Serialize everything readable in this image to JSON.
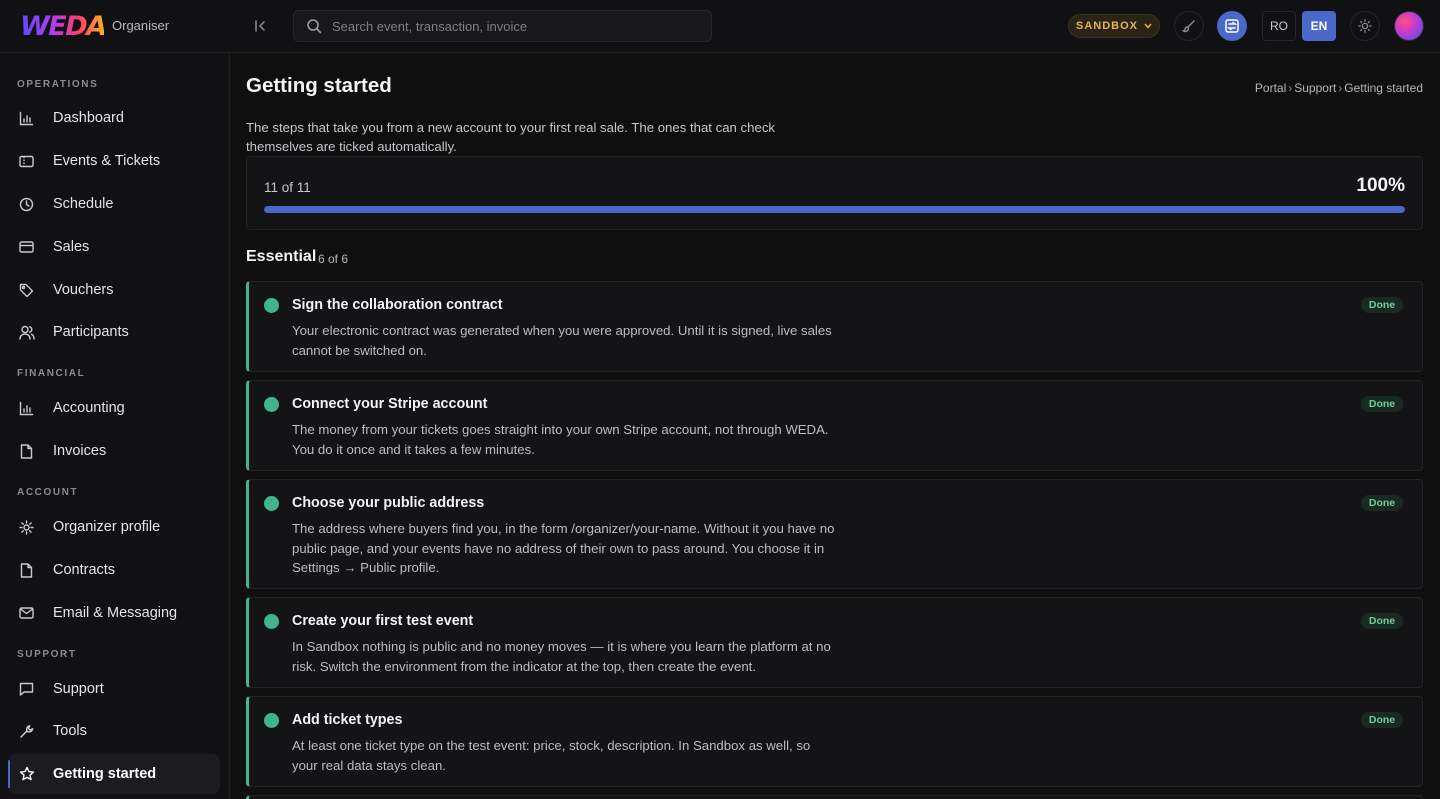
{
  "header": {
    "brand": "WEDA",
    "brand_sub": "Organiser",
    "search_placeholder": "Search event, transaction, invoice",
    "env_label": "SANDBOX",
    "lang_ro": "RO",
    "lang_en": "EN",
    "active_lang": "EN"
  },
  "sidebar": {
    "sections": [
      {
        "title": "OPERATIONS",
        "items": [
          {
            "label": "Dashboard",
            "icon": "chart-icon"
          },
          {
            "label": "Events & Tickets",
            "icon": "ticket-icon"
          },
          {
            "label": "Schedule",
            "icon": "clock-icon"
          },
          {
            "label": "Sales",
            "icon": "card-icon"
          },
          {
            "label": "Vouchers",
            "icon": "tag-icon"
          },
          {
            "label": "Participants",
            "icon": "users-icon"
          }
        ]
      },
      {
        "title": "FINANCIAL",
        "items": [
          {
            "label": "Accounting",
            "icon": "chart-icon"
          },
          {
            "label": "Invoices",
            "icon": "document-icon"
          }
        ]
      },
      {
        "title": "ACCOUNT",
        "items": [
          {
            "label": "Organizer profile",
            "icon": "gear-icon"
          },
          {
            "label": "Contracts",
            "icon": "document-icon"
          },
          {
            "label": "Email & Messaging",
            "icon": "mail-icon"
          }
        ]
      },
      {
        "title": "SUPPORT",
        "items": [
          {
            "label": "Support",
            "icon": "chat-icon"
          },
          {
            "label": "Tools",
            "icon": "wrench-icon"
          },
          {
            "label": "Getting started",
            "icon": "star-icon",
            "active": true
          }
        ]
      }
    ]
  },
  "main": {
    "title": "Getting started",
    "breadcrumb": [
      "Portal",
      "Support",
      "Getting started"
    ],
    "intro": "The steps that take you from a new account to your first real sale. The ones that can check themselves are ticked automatically.",
    "progress": {
      "label": "11 of 11",
      "percent_label": "100%",
      "fraction": 1.0
    },
    "group": {
      "title": "Essential",
      "count": "6 of 6"
    },
    "tasks": [
      {
        "title": "Sign the collaboration contract",
        "desc": "Your electronic contract was generated when you were approved. Until it is signed, live sales cannot be switched on.",
        "status": "Done"
      },
      {
        "title": "Connect your Stripe account",
        "desc": "The money from your tickets goes straight into your own Stripe account, not through WEDA. You do it once and it takes a few minutes.",
        "status": "Done"
      },
      {
        "title": "Choose your public address",
        "desc": "The address where buyers find you, in the form /organizer/your-name. Without it you have no public page, and your events have no address of their own to pass around. You choose it in Settings → Public profile.",
        "status": "Done"
      },
      {
        "title": "Create your first test event",
        "desc": "In Sandbox nothing is public and no money moves — it is where you learn the platform at no risk. Switch the environment from the indicator at the top, then create the event.",
        "status": "Done"
      },
      {
        "title": "Add ticket types",
        "desc": "At least one ticket type on the test event: price, stock, description. In Sandbox as well, so your real data stays clean.",
        "status": "Done"
      }
    ]
  },
  "colors": {
    "accent": "#4a68c9",
    "done": "#3fb58c",
    "sandbox": "#e9b44c"
  }
}
